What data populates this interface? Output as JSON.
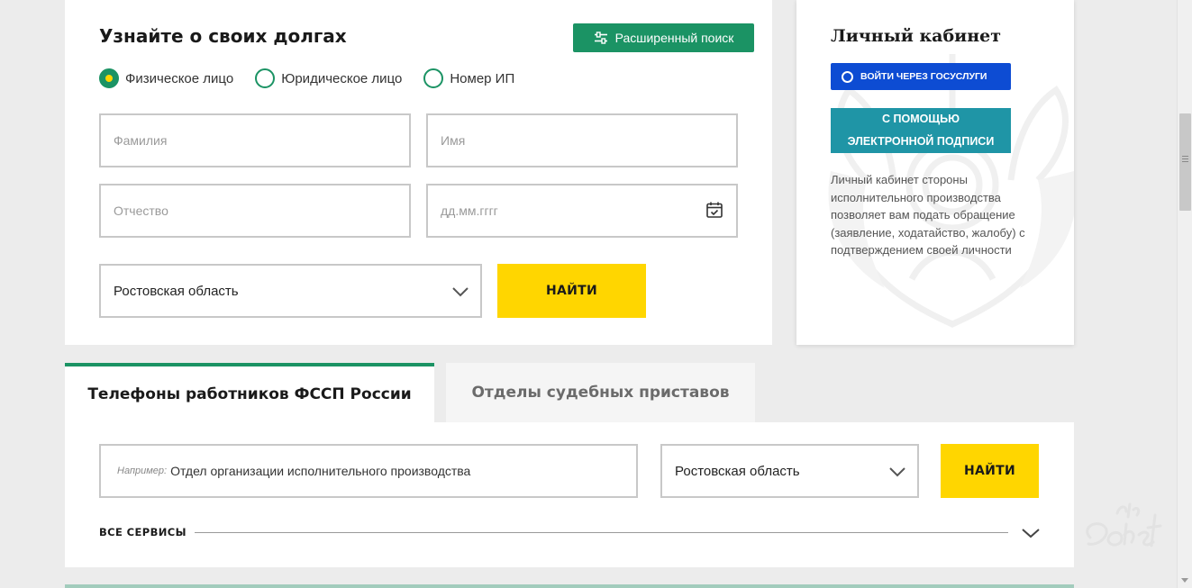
{
  "search": {
    "title": "Узнайте о своих долгах",
    "advanced_button": "Расширенный поиск",
    "person_types": [
      {
        "label": "Физическое лицо",
        "checked": true
      },
      {
        "label": "Юридическое лицо",
        "checked": false
      },
      {
        "label": "Номер ИП",
        "checked": false
      }
    ],
    "fields": {
      "surname_placeholder": "Фамилия",
      "name_placeholder": "Имя",
      "patronymic_placeholder": "Отчество",
      "birthdate_placeholder": "дд.мм.гггг"
    },
    "region": "Ростовская область",
    "find_button": "НАЙТИ"
  },
  "cabinet": {
    "title": "Личный кабинет",
    "gosuslugi_button": "ВОЙТИ ЧЕРЕЗ ГОСУСЛУГИ",
    "eds_button_line1": "С ПОМОЩЬЮ",
    "eds_button_line2": "ЭЛЕКТРОННОЙ ПОДПИСИ",
    "description": "Личный кабинет стороны исполнительного производства позволяет вам подать обращение (заявление, ходатайство, жалобу) с подтверждением своей личности"
  },
  "tabs": [
    {
      "label": "Телефоны работников ФССП России",
      "active": true
    },
    {
      "label": "Отделы судебных приставов",
      "active": false
    }
  ],
  "phones": {
    "example_prefix": "Например:",
    "example_placeholder": "Отдел организации исполнительного производства",
    "region": "Ростовская область",
    "find_button": "НАЙТИ"
  },
  "services": {
    "label": "ВСЕ СЕРВИСЫ"
  },
  "colors": {
    "accent_green": "#1b9364",
    "button_yellow": "#ffd600",
    "gosuslugi_blue": "#0d4cd3",
    "eds_teal": "#1f95a6"
  },
  "icons": {
    "advanced": "sliders-icon",
    "calendar": "calendar-icon",
    "dropdown": "chevron-down-icon",
    "gosuslugi": "ring-icon"
  }
}
